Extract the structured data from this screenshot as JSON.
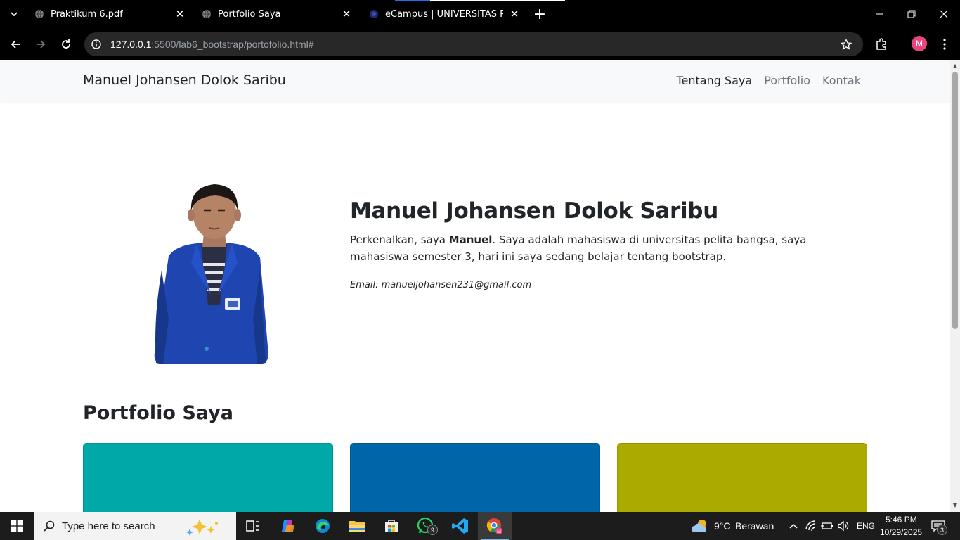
{
  "browser": {
    "tabs": [
      {
        "title": "Praktikum 6.pdf",
        "close": "✕"
      },
      {
        "title": "Portfolio Saya",
        "close": "✕"
      },
      {
        "title": "eCampus | UNIVERSITAS PELITA",
        "close": "✕"
      }
    ],
    "new_tab": "+",
    "url": {
      "host": "127.0.0.1",
      "path": ":5500/lab6_bootstrap/portofolio.html#"
    },
    "profile_initial": "M"
  },
  "page": {
    "navbar": {
      "brand": "Manuel Johansen Dolok Saribu",
      "links": [
        "Tentang Saya",
        "Portfolio",
        "Kontak"
      ]
    },
    "hero": {
      "name": "Manuel Johansen Dolok Saribu",
      "intro_before": "Perkenalkan, saya ",
      "intro_name": "Manuel",
      "intro_after": ". Saya adalah mahasiswa di universitas pelita bangsa, saya mahasiswa semester 3, hari ini saya sedang belajar tentang bootstrap.",
      "email": "Email: manueljohansen231@gmail.com"
    },
    "portfolio": {
      "title": "Portfolio Saya",
      "card_colors": [
        "#00a8a8",
        "#0066aa",
        "#aaaa00"
      ]
    }
  },
  "taskbar": {
    "search_placeholder": "Type here to search",
    "whatsapp_badge": "9",
    "weather": {
      "temp": "9°C",
      "desc": "Berawan"
    },
    "language": "ENG",
    "time": "5:46 PM",
    "date": "10/29/2025",
    "notifications": "3"
  }
}
